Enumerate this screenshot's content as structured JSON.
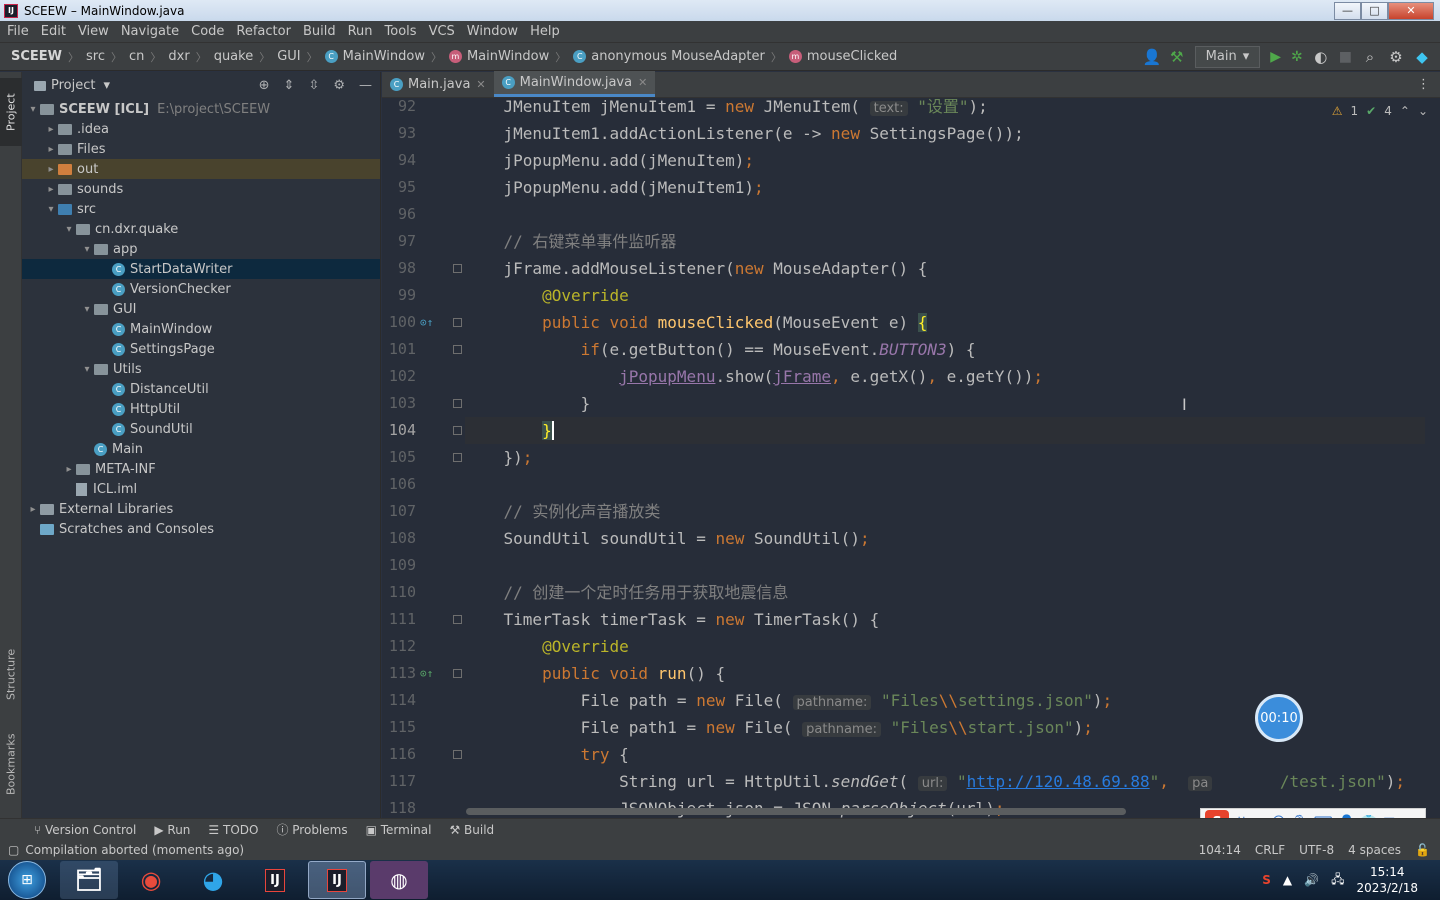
{
  "window": {
    "title": "SCEEW – MainWindow.java",
    "buttons": [
      "—",
      "□",
      "✕"
    ]
  },
  "menu": [
    "File",
    "Edit",
    "View",
    "Navigate",
    "Code",
    "Refactor",
    "Build",
    "Run",
    "Tools",
    "VCS",
    "Window",
    "Help"
  ],
  "breadcrumbs": [
    "SCEEW",
    "src",
    "cn",
    "dxr",
    "quake",
    "GUI",
    "MainWindow",
    "MainWindow",
    "anonymous MouseAdapter",
    "mouseClicked"
  ],
  "run_config": "Main",
  "project": {
    "header": "Project",
    "tree": [
      {
        "label": "SCEEW [ICL]",
        "path": "E:\\project\\SCEEW",
        "level": 0,
        "open": true,
        "kind": "module"
      },
      {
        "label": ".idea",
        "level": 1,
        "open": false,
        "kind": "folder"
      },
      {
        "label": "Files",
        "level": 1,
        "open": false,
        "kind": "folder"
      },
      {
        "label": "out",
        "level": 1,
        "open": false,
        "kind": "orange"
      },
      {
        "label": "sounds",
        "level": 1,
        "open": false,
        "kind": "folder"
      },
      {
        "label": "src",
        "level": 1,
        "open": true,
        "kind": "blue"
      },
      {
        "label": "cn.dxr.quake",
        "level": 2,
        "open": true,
        "kind": "pkg"
      },
      {
        "label": "app",
        "level": 3,
        "open": true,
        "kind": "pkg"
      },
      {
        "label": "StartDataWriter",
        "level": 4,
        "kind": "class",
        "selected": true
      },
      {
        "label": "VersionChecker",
        "level": 4,
        "kind": "class"
      },
      {
        "label": "GUI",
        "level": 3,
        "open": true,
        "kind": "pkg"
      },
      {
        "label": "MainWindow",
        "level": 4,
        "kind": "class"
      },
      {
        "label": "SettingsPage",
        "level": 4,
        "kind": "class"
      },
      {
        "label": "Utils",
        "level": 3,
        "open": true,
        "kind": "pkg"
      },
      {
        "label": "DistanceUtil",
        "level": 4,
        "kind": "class"
      },
      {
        "label": "HttpUtil",
        "level": 4,
        "kind": "class"
      },
      {
        "label": "SoundUtil",
        "level": 4,
        "kind": "class"
      },
      {
        "label": "Main",
        "level": 3,
        "kind": "class"
      },
      {
        "label": "META-INF",
        "level": 2,
        "open": false,
        "kind": "folder"
      },
      {
        "label": "ICL.iml",
        "level": 2,
        "kind": "file"
      },
      {
        "label": "External Libraries",
        "level": 0,
        "open": false,
        "kind": "lib"
      },
      {
        "label": "Scratches and Consoles",
        "level": 0,
        "kind": "scratch"
      }
    ]
  },
  "stripe": {
    "project": "Project",
    "structure": "Structure",
    "bookmarks": "Bookmarks"
  },
  "tabs": [
    {
      "label": "Main.java",
      "active": false
    },
    {
      "label": "MainWindow.java",
      "active": true
    }
  ],
  "inspection": {
    "warnings": "1",
    "ok": "4"
  },
  "current_line": 104,
  "line_numbers": [
    "92",
    "93",
    "94",
    "95",
    "96",
    "97",
    "98",
    "99",
    "100",
    "101",
    "102",
    "103",
    "104",
    "105",
    "106",
    "107",
    "108",
    "109",
    "110",
    "111",
    "112",
    "113",
    "114",
    "115",
    "116",
    "117",
    "118"
  ],
  "timer": "00:10",
  "ime_label": "英",
  "bottom_tools": [
    "Version Control",
    "Run",
    "TODO",
    "Problems",
    "Terminal",
    "Build"
  ],
  "status": {
    "message": "Compilation aborted (moments ago)",
    "position": "104:14",
    "line_sep": "CRLF",
    "encoding": "UTF-8",
    "indent": "4 spaces"
  },
  "taskbar": {
    "time": "15:14",
    "date": "2023/2/18"
  },
  "colors": {
    "keyword": "#cc7832",
    "function": "#ffc66d",
    "string": "#6a8759",
    "comment": "#808080",
    "annotation": "#bbb529",
    "field": "#9876aa"
  }
}
